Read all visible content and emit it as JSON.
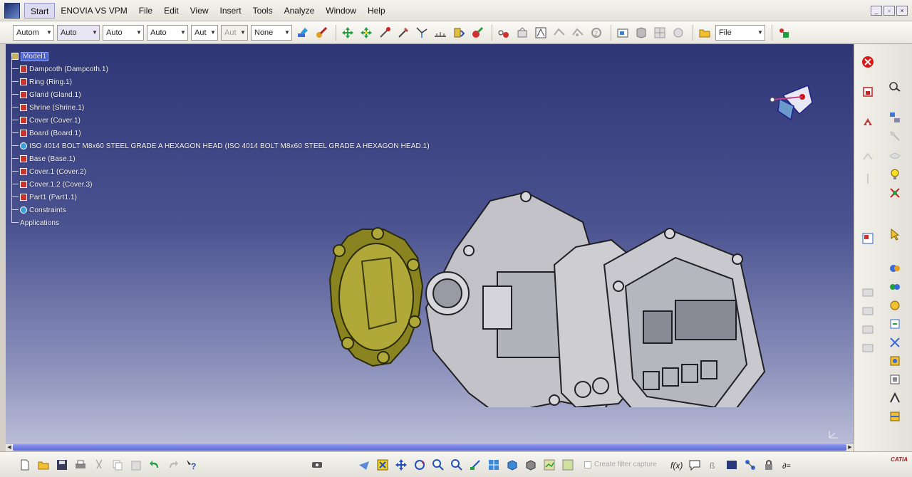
{
  "menubar": {
    "items": [
      "Start",
      "ENOVIA VS VPM",
      "File",
      "Edit",
      "View",
      "Insert",
      "Tools",
      "Analyze",
      "Window",
      "Help"
    ],
    "window_controls": [
      "_",
      "▫",
      "×"
    ]
  },
  "toolbar": {
    "combos": [
      {
        "value": "Autom"
      },
      {
        "value": "Auto"
      },
      {
        "value": "Auto"
      },
      {
        "value": "Auto"
      },
      {
        "value": "Aut"
      },
      {
        "value": "Aut"
      },
      {
        "value": "None"
      }
    ],
    "file_combo": "File"
  },
  "tree": {
    "root": "Model1",
    "nodes": [
      "Dampcoth (Dampcoth.1)",
      "Ring (Ring.1)",
      "Gland (Gland.1)",
      "Shrine (Shrine.1)",
      "Cover (Cover.1)",
      "Board (Board.1)",
      "ISO 4014 BOLT M8x60 STEEL GRADE A HEXAGON HEAD (ISO 4014 BOLT M8x60 STEEL GRADE A HEXAGON HEAD.1)",
      "Base (Base.1)",
      "Cover.1 (Cover.2)",
      "Cover.1.2 (Cover.3)",
      "Part1 (Part1.1)",
      "Constraints",
      "Applications"
    ]
  },
  "bottom": {
    "create_filter_label": "Create filter capture",
    "logo_text": "CATIA"
  }
}
